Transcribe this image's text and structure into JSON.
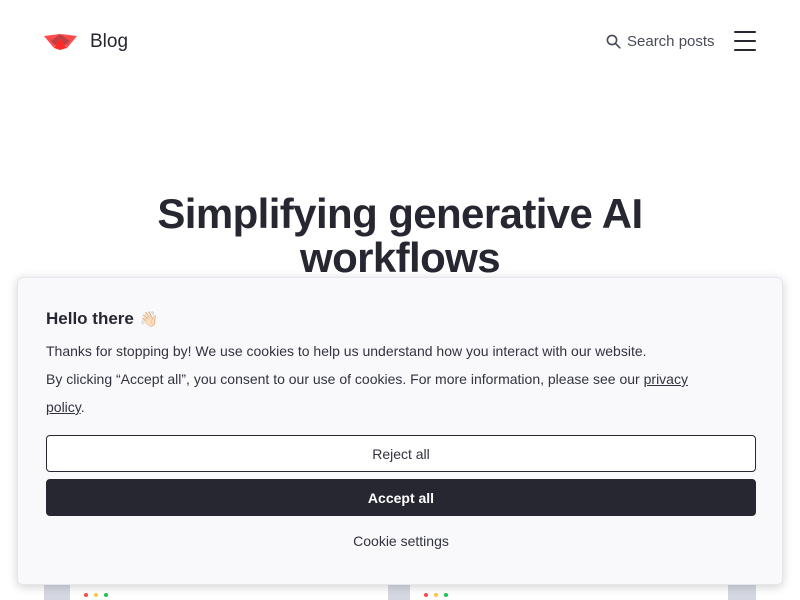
{
  "header": {
    "brand": "Blog",
    "search_label": "Search posts",
    "logo_icon": "streamlit-crown-icon",
    "logo_color": "#ff4b4b"
  },
  "hero": {
    "title_line1": "Simplifying generative AI",
    "title_line2": "workflows"
  },
  "cookie_banner": {
    "title": "Hello there",
    "title_emoji": "👋🏻",
    "text_1": "Thanks for stopping by! We use cookies to help us understand how you interact with our website.",
    "text_2_prefix": "By clicking “Accept all”, you consent to our use of cookies. For more information, please see our ",
    "privacy_link": "privacy policy",
    "text_2_suffix": ".",
    "reject_label": "Reject all",
    "accept_label": "Accept all",
    "settings_label": "Cookie settings"
  },
  "colors": {
    "text_dark": "#262730",
    "accept_bg": "#262730",
    "modal_bg": "#f9f9fb",
    "dot_red": "#ff4b4b",
    "dot_yellow": "#ffc845",
    "dot_green": "#21c354"
  }
}
